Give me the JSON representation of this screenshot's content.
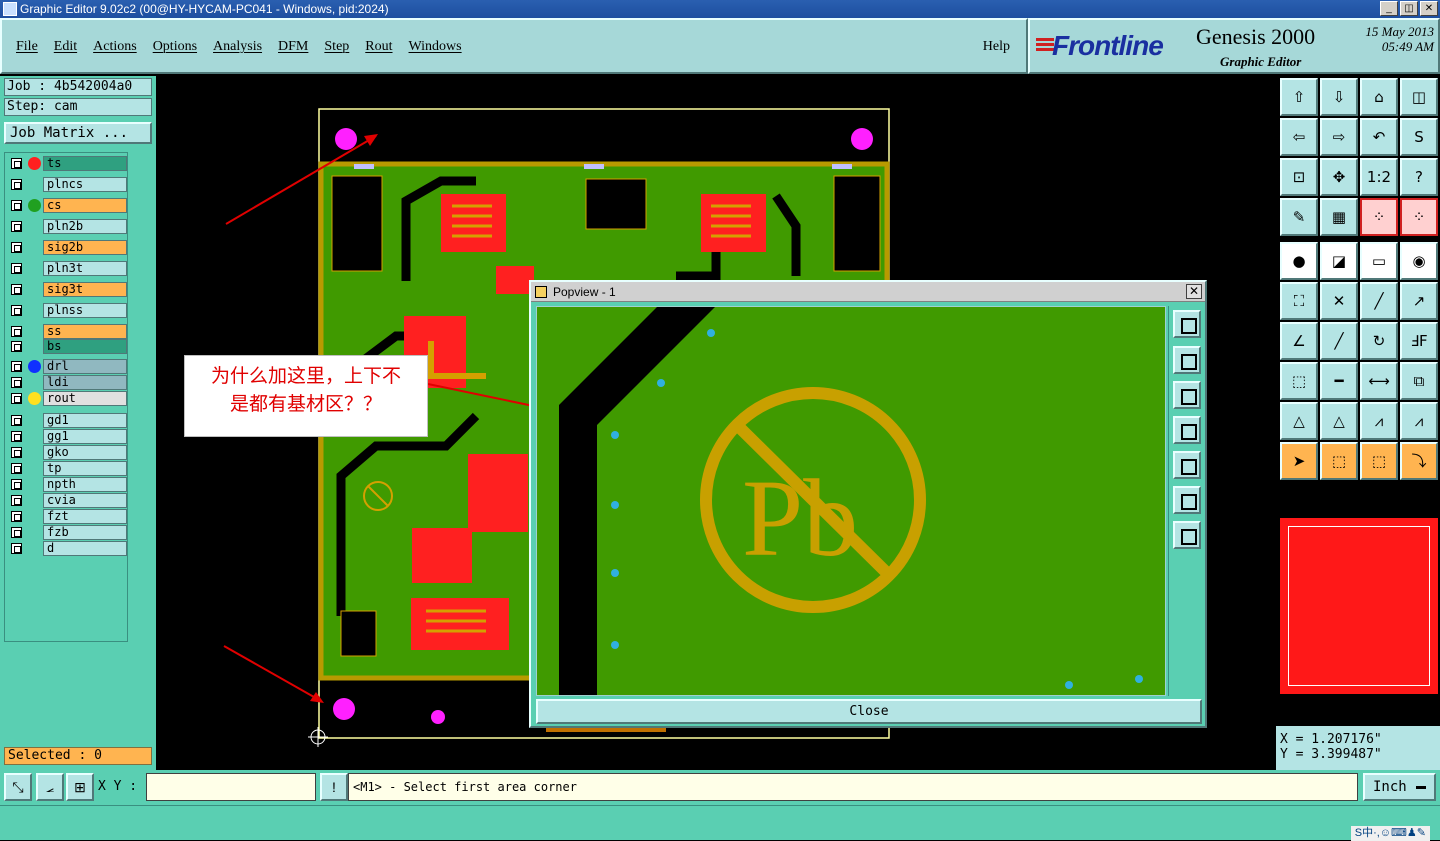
{
  "window": {
    "title": "Graphic Editor 9.02c2 (00@HY-HYCAM-PC041 - Windows, pid:2024)",
    "min_label": "_",
    "max_label": "◫",
    "close_label": "✕"
  },
  "menu": {
    "items": [
      "File",
      "Edit",
      "Actions",
      "Options",
      "Analysis",
      "DFM",
      "Step",
      "Rout",
      "Windows"
    ],
    "help": "Help"
  },
  "brand": {
    "logo": "Frontline",
    "product": "Genesis 2000",
    "subtitle": "Graphic Editor",
    "date": "15 May 2013",
    "time": "05:49 AM"
  },
  "job": {
    "job_label": "Job : 4b542004a0",
    "step_label": "Step: cam",
    "matrix_button": "Job Matrix ..."
  },
  "layers": [
    {
      "name": "ts",
      "dot": "#ff2020",
      "state": "board"
    },
    {
      "name": "plncs",
      "dot": "",
      "state": "normal"
    },
    {
      "name": "cs",
      "dot": "#20a020",
      "state": "active"
    },
    {
      "name": "pln2b",
      "dot": "",
      "state": "normal"
    },
    {
      "name": "sig2b",
      "dot": "",
      "state": "active"
    },
    {
      "name": "pln3t",
      "dot": "",
      "state": "normal"
    },
    {
      "name": "sig3t",
      "dot": "",
      "state": "active"
    },
    {
      "name": "plnss",
      "dot": "",
      "state": "normal"
    },
    {
      "name": "ss",
      "dot": "",
      "state": "active"
    },
    {
      "name": "bs",
      "dot": "",
      "state": "board"
    },
    {
      "name": "drl",
      "dot": "#1030ff",
      "state": "drill"
    },
    {
      "name": "ldi",
      "dot": "",
      "state": "drill"
    },
    {
      "name": "rout",
      "dot": "#ffe020",
      "state": "rout"
    },
    {
      "name": "gd1",
      "dot": "",
      "state": "normal"
    },
    {
      "name": "gg1",
      "dot": "",
      "state": "normal"
    },
    {
      "name": "gko",
      "dot": "",
      "state": "normal"
    },
    {
      "name": "tp",
      "dot": "",
      "state": "normal"
    },
    {
      "name": "npth",
      "dot": "",
      "state": "normal"
    },
    {
      "name": "cvia",
      "dot": "",
      "state": "normal"
    },
    {
      "name": "fzt",
      "dot": "",
      "state": "normal"
    },
    {
      "name": "fzb",
      "dot": "",
      "state": "normal"
    },
    {
      "name": "d",
      "dot": "",
      "state": "normal"
    }
  ],
  "selected": "Selected : 0",
  "popview": {
    "title": "Popview - 1",
    "close_button": "Close",
    "pb_text": "Pb"
  },
  "annotation": {
    "line1": "为什么加这里，上下不",
    "line2": "是都有基材区？？"
  },
  "coords": {
    "x": "X = 1.207176\"",
    "y": "Y = 3.399487\""
  },
  "status": {
    "xy_label": "X Y :",
    "xy_value": "",
    "prompt": "<M1> - Select first area corner",
    "unit": "Inch"
  },
  "ime": "S中·,☺⌨♟✎"
}
